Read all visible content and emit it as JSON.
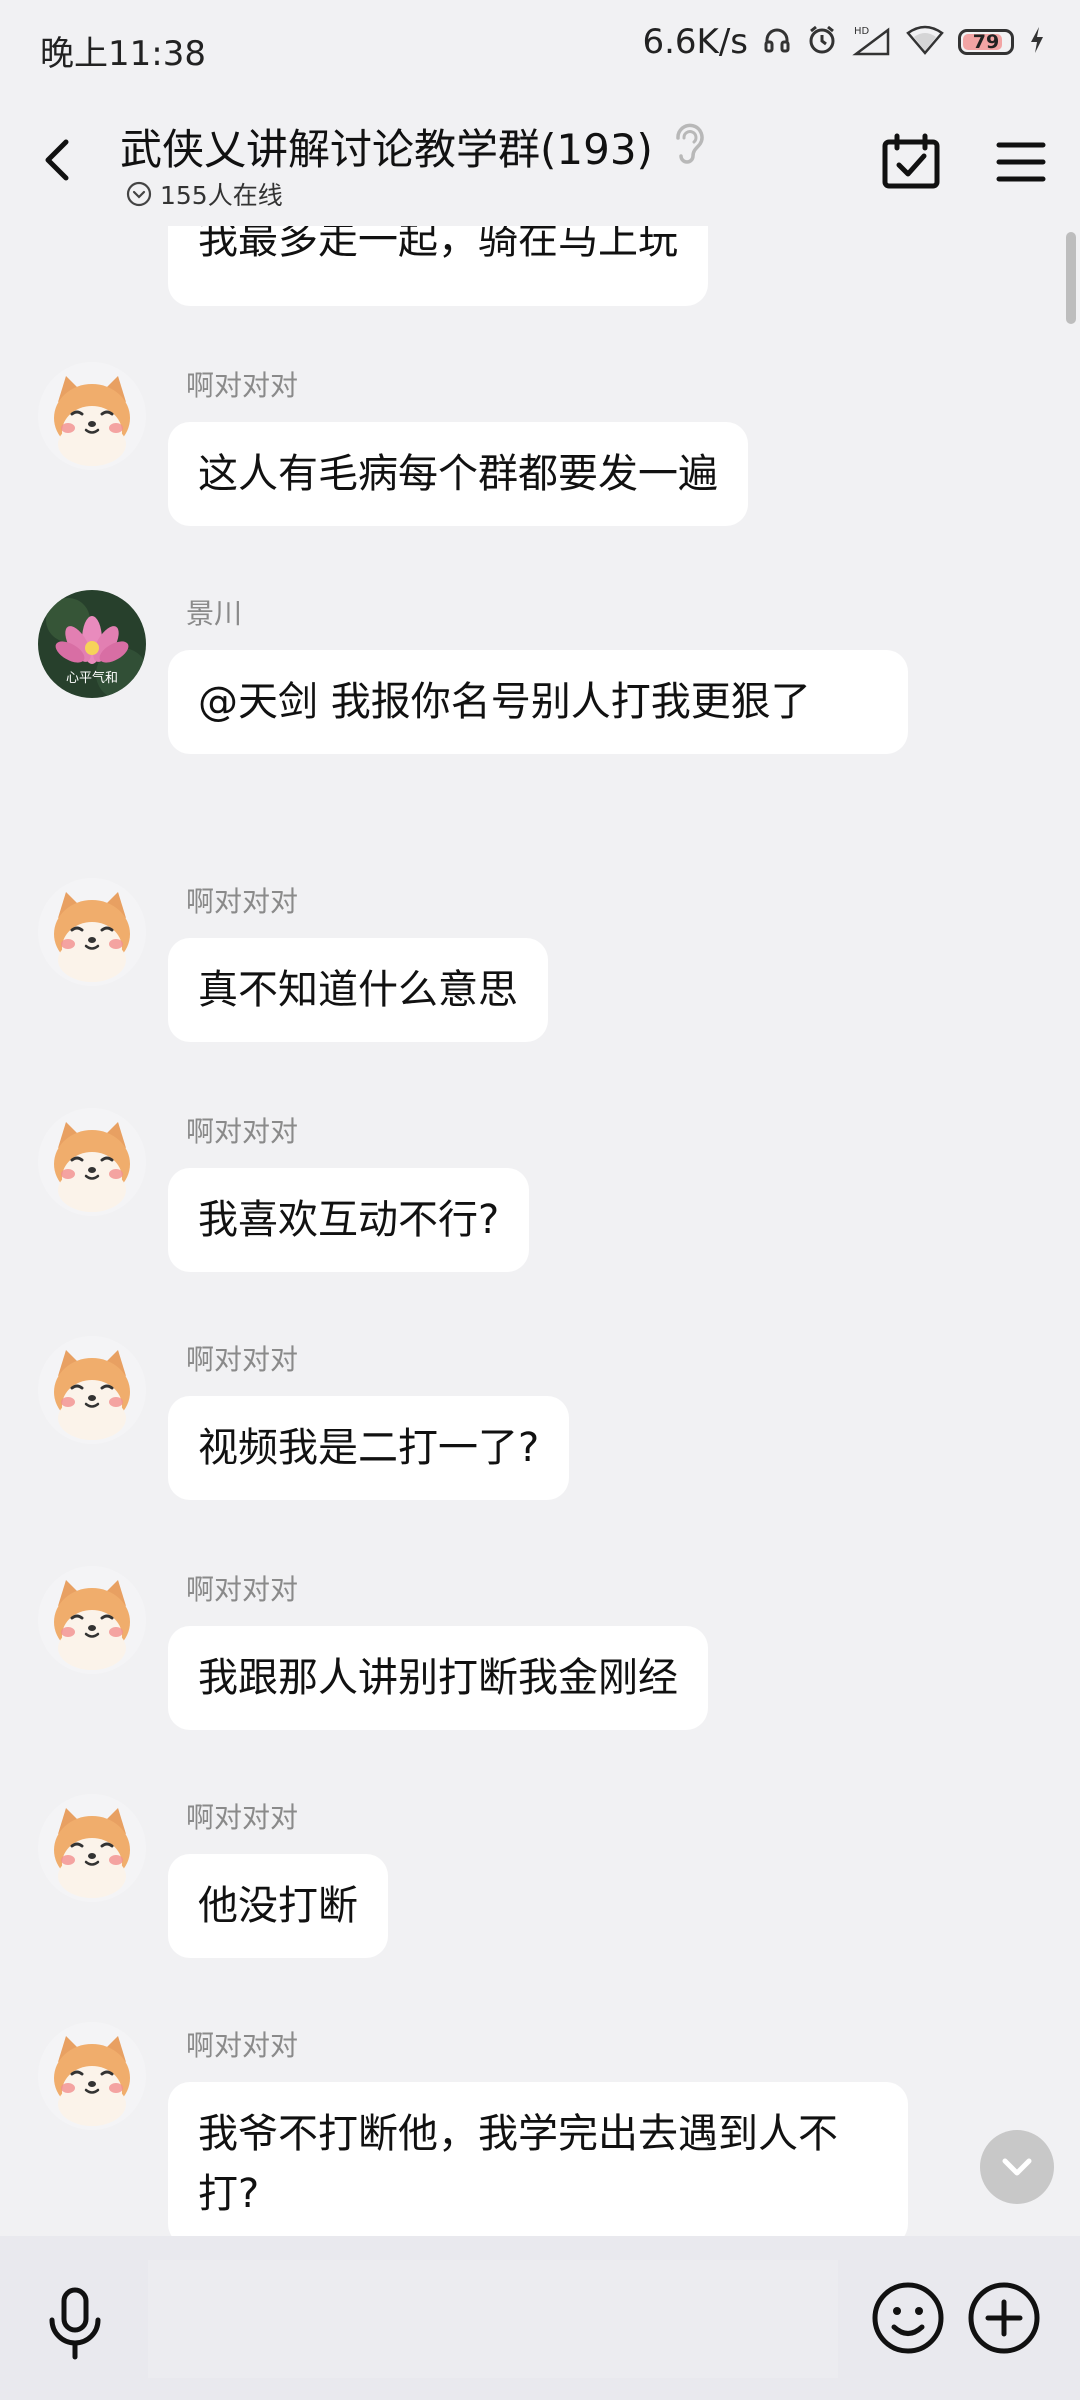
{
  "status_bar": {
    "time": "晚上11:38",
    "net_speed": "6.6K/s",
    "battery_level": "79",
    "icons": [
      "headphones-icon",
      "alarm-icon",
      "hd-signal-icon",
      "wifi-icon",
      "battery-icon",
      "charging-icon"
    ]
  },
  "header": {
    "title": "武侠乂讲解讨论教学群(193)",
    "online_text": "155人在线",
    "icons": [
      "back-icon",
      "ear-icon",
      "calendar-check-icon",
      "menu-icon"
    ]
  },
  "messages": [
    {
      "sender": "",
      "avatar": "shiba-avatar",
      "text": "我最多走一起，骑在马上玩"
    },
    {
      "sender": "啊对对对",
      "avatar": "shiba-avatar",
      "text": "这人有毛病每个群都要发一遍"
    },
    {
      "sender": "景川",
      "avatar": "lotus-avatar",
      "avatar_text": "心平气和",
      "text": "@天剑 我报你名号别人打我更狠了"
    },
    {
      "sender": "啊对对对",
      "avatar": "shiba-avatar",
      "text": "真不知道什么意思"
    },
    {
      "sender": "啊对对对",
      "avatar": "shiba-avatar",
      "text": "我喜欢互动不行?"
    },
    {
      "sender": "啊对对对",
      "avatar": "shiba-avatar",
      "text": "视频我是二打一了?"
    },
    {
      "sender": "啊对对对",
      "avatar": "shiba-avatar",
      "text": "我跟那人讲别打断我金刚经"
    },
    {
      "sender": "啊对对对",
      "avatar": "shiba-avatar",
      "text": "他没打断"
    },
    {
      "sender": "啊对对对",
      "avatar": "shiba-avatar",
      "text": "我爷不打断他，我学完出去遇到人不打?"
    }
  ],
  "input_bar": {
    "placeholder": "",
    "icons": [
      "microphone-icon",
      "emoji-icon",
      "plus-icon",
      "chevron-down-icon"
    ]
  },
  "colors": {
    "background": "#f1f1f3",
    "bubble": "#ffffff",
    "sender": "#8a8a8a",
    "input_bar": "#e9e9ee"
  }
}
